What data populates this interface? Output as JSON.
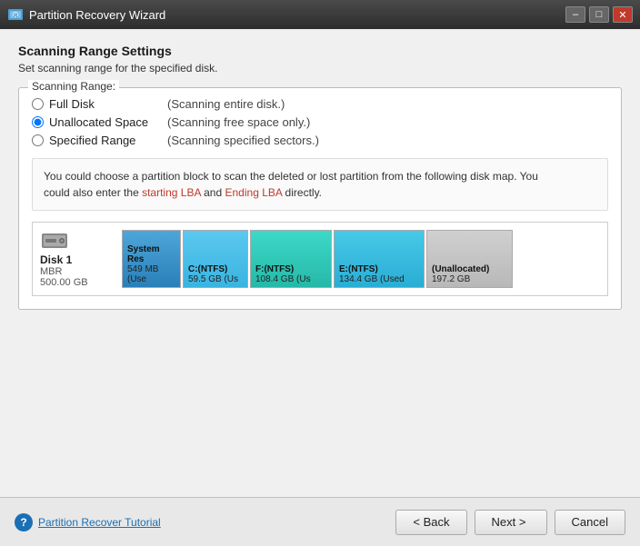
{
  "titlebar": {
    "title": "Partition Recovery Wizard",
    "minimize_label": "–",
    "maximize_label": "□",
    "close_label": "✕"
  },
  "header": {
    "title": "Scanning Range Settings",
    "subtitle": "Set scanning range for the specified disk."
  },
  "scanning_range": {
    "legend": "Scanning Range:",
    "options": [
      {
        "id": "full-disk",
        "label": "Full Disk",
        "desc": "(Scanning entire disk.)",
        "checked": false
      },
      {
        "id": "unallocated",
        "label": "Unallocated Space",
        "desc": "(Scanning free space only.)",
        "checked": true
      },
      {
        "id": "specified",
        "label": "Specified Range",
        "desc": "(Scanning specified sectors.)",
        "checked": false
      }
    ]
  },
  "info_text": {
    "line1": "You could choose a partition block to scan the deleted or lost partition from the following disk map. You",
    "line2": "could also enter the starting LBA and Ending LBA directly."
  },
  "disk": {
    "name": "Disk 1",
    "type": "MBR",
    "size": "500.00 GB",
    "partitions": [
      {
        "label": "System Res",
        "size": "549 MB (Use",
        "class": "part-sysres"
      },
      {
        "label": "C:(NTFS)",
        "size": "59.5 GB (Us",
        "class": "part-c"
      },
      {
        "label": "F:(NTFS)",
        "size": "108.4 GB (Us",
        "class": "part-f"
      },
      {
        "label": "E:(NTFS)",
        "size": "134.4 GB (Used",
        "class": "part-e"
      },
      {
        "label": "(Unallocated)",
        "size": "197.2 GB",
        "class": "part-unalloc"
      }
    ]
  },
  "bottom": {
    "help_label": "Partition Recover Tutorial",
    "back_label": "< Back",
    "next_label": "Next >",
    "cancel_label": "Cancel"
  }
}
